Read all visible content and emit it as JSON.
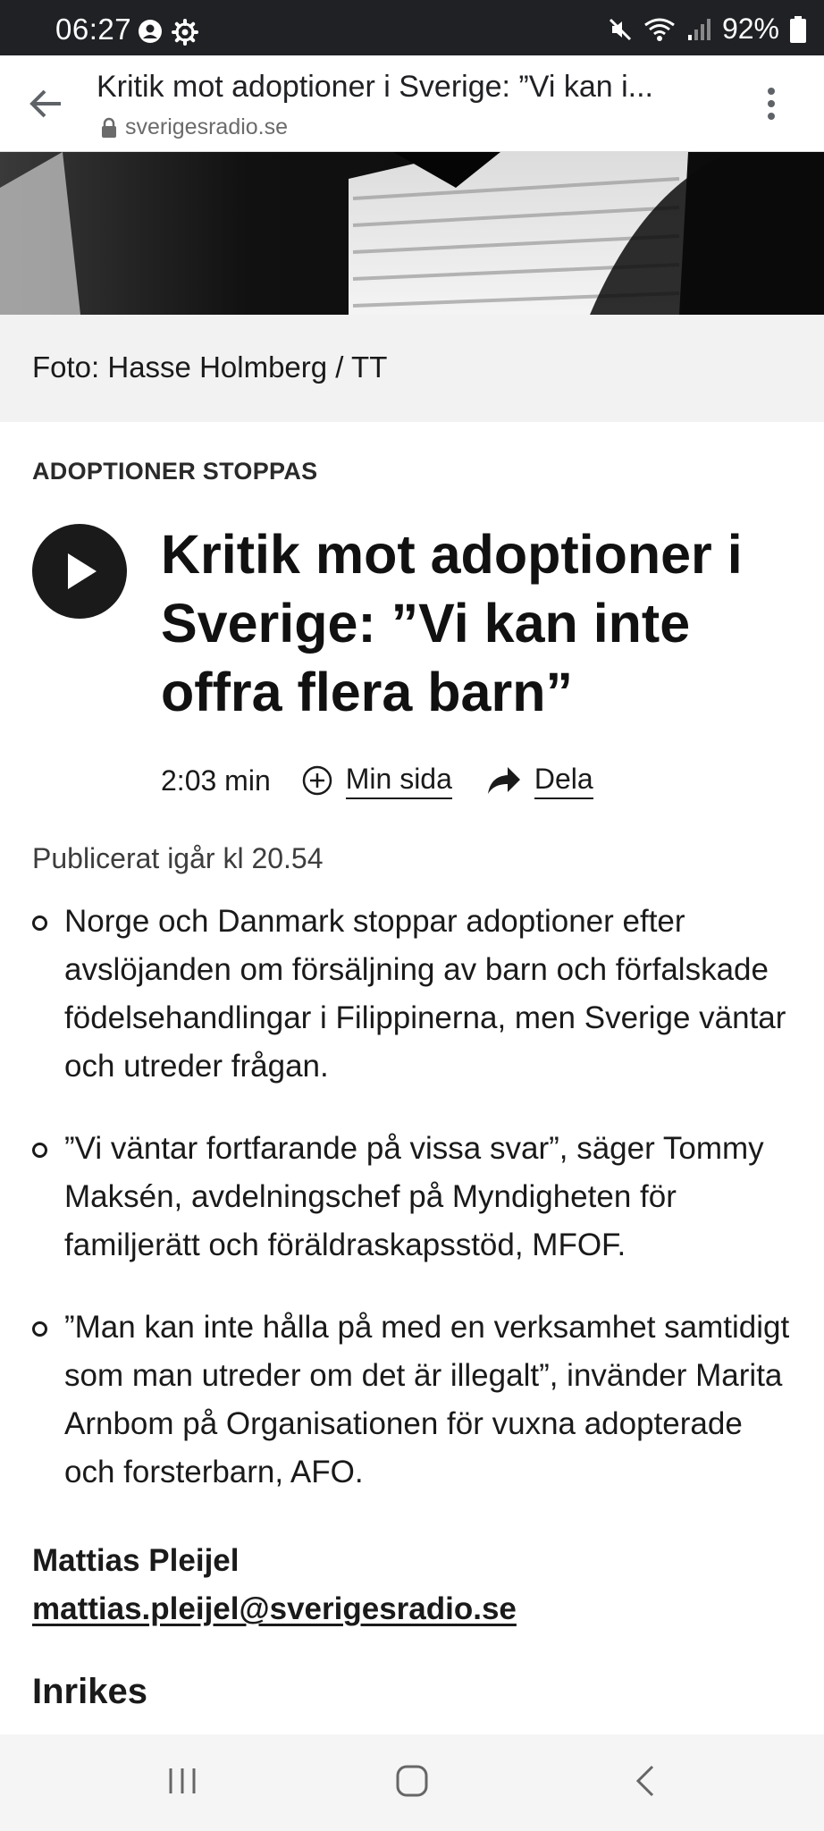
{
  "status_bar": {
    "time": "06:27",
    "battery": "92%",
    "icons": [
      "account-circle-icon",
      "settings-gear-icon",
      "mute-icon",
      "wifi-icon",
      "signal-icon",
      "battery-icon"
    ]
  },
  "browser": {
    "page_title": "Kritik mot adoptioner i Sverige: ”Vi kan i...",
    "domain": "sverigesradio.se"
  },
  "article": {
    "photo_caption": "Foto: Hasse Holmberg / TT",
    "kicker": "ADOPTIONER STOPPAS",
    "headline": "Kritik mot adoptioner i Sverige: ”Vi kan inte offra flera barn”",
    "duration": "2:03 min",
    "my_page_label": "Min sida",
    "share_label": "Dela",
    "published": "Publicerat igår kl 20.54",
    "bullets": [
      "Norge och Danmark stoppar adoptioner efter avslöjanden om försäljning av barn och förfalskade födelsehandlingar i Filippinerna, men Sverige väntar och utreder frågan.",
      "”Vi väntar fortfarande på vissa svar”, säger Tommy Maksén, avdelningschef på Myndigheten för familjerätt och föräldraskapsstöd, MFOF.",
      "”Man kan inte hålla på med en verksamhet samtidigt som man utreder om det är illegalt”, invänder Marita Arnbom på Organisationen för vuxna adopterade och forsterbarn, AFO."
    ],
    "author_name": "Mattias Pleijel",
    "author_email": "mattias.pleijel@sverigesradio.se",
    "section": "Inrikes"
  },
  "colors": {
    "status_bar_bg": "#1f2124",
    "caption_bg": "#f2f2f2",
    "text": "#1a1a1a",
    "nav_bar_bg": "#f5f5f5"
  }
}
